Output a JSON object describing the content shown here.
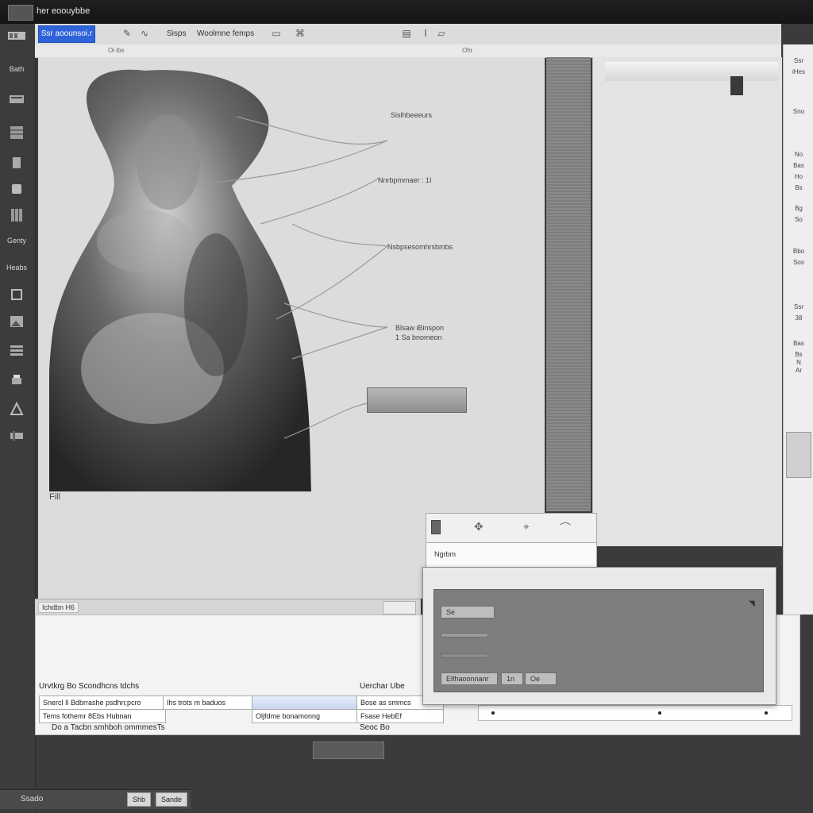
{
  "window": {
    "title": "her eoouybbe"
  },
  "rail": {
    "labels": [
      "Bath",
      "Genty",
      "Heabs"
    ]
  },
  "toolbar": {
    "primary_label": "Ssr aoounsoi.r",
    "items": [
      "Sisps",
      "Woolmne femps"
    ]
  },
  "ruler": {
    "marks": [
      "Oi ibs",
      "Ohr"
    ]
  },
  "annotations": {
    "labels": [
      "Sislhbeeeurs",
      "Nnrbpmmaer : 1I",
      "Nsbpsesomhrsbmbs",
      "Blsaw iBinspon",
      "1 Sa bnomeon"
    ],
    "figure_label": "Fill"
  },
  "right_column": {
    "labels": [
      "Ssr",
      "iHes",
      "Sno",
      "No",
      "Bas",
      "Ho",
      "Bs",
      "Bg",
      "So",
      "Bbo",
      "Sos",
      "Ssr",
      "38",
      "Bas",
      "Bs",
      "N",
      "Ar"
    ]
  },
  "status": {
    "label": "Ichdbn H6",
    "button": ""
  },
  "mini_menu": {
    "label": "Ngrbm"
  },
  "dialog": {
    "field1": "Se",
    "footer_label": "Elfhaoonnanr",
    "buttons": [
      "1n",
      "Oe"
    ]
  },
  "bottom": {
    "rows": [
      {
        "col1": "Urvtkrg Bo Scondhcns tdchs",
        "col2": "",
        "col3": "Uerchar  Ube"
      },
      {
        "col1": "Snercl Il Bdbrrashe psdhn;pcro",
        "col2": "Ihs trots m baduos",
        "col3": "Bose as smmcs"
      },
      {
        "col1": "Tems  fothemr  8Ebs Hubnan",
        "col2": "Oljfdme bonamonng",
        "col3": "Fsase HebEf"
      },
      {
        "col1": "Do a Tacbn smhboh ommmesTs",
        "col2": "",
        "col3": "Seoc  Bo"
      }
    ],
    "slider_value": ""
  },
  "taskbar": {
    "label": ""
  },
  "footer": {
    "label": "Ssado",
    "buttons": [
      "Shb",
      "Sande"
    ]
  }
}
